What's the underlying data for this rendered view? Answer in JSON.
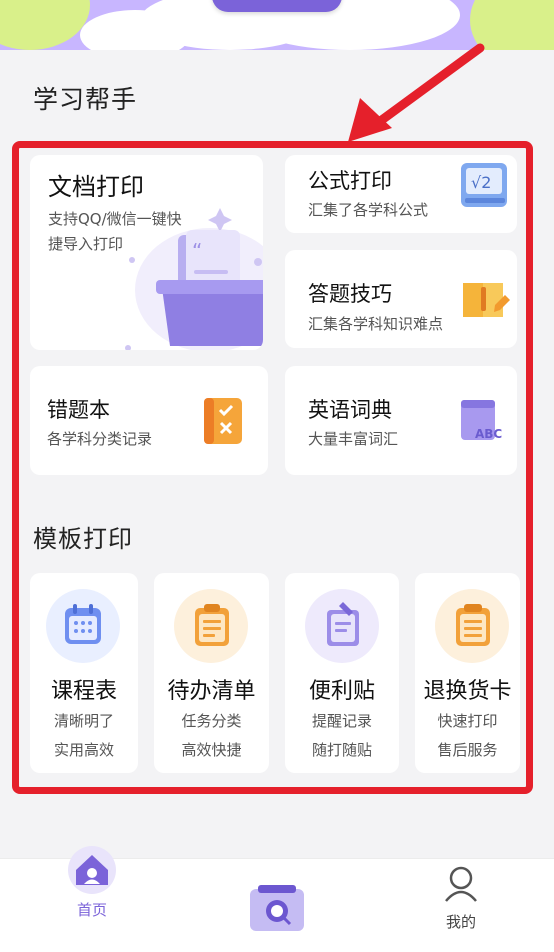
{
  "colors": {
    "accent": "#7b63d9",
    "highlight_frame": "#e5202b",
    "tab_active": "#7b63d9",
    "tab_inactive": "#444444"
  },
  "study_section": {
    "title": "学习帮手",
    "cards": [
      {
        "title": "文档打印",
        "subtitle": "支持QQ/微信一键快\n捷导入打印",
        "icon": "document-folder-icon"
      },
      {
        "title": "公式打印",
        "subtitle": "汇集了各学科公式",
        "icon": "formula-board-icon"
      },
      {
        "title": "答题技巧",
        "subtitle": "汇集各学科知识难点",
        "icon": "book-pencil-icon"
      },
      {
        "title": "错题本",
        "subtitle": "各学科分类记录",
        "icon": "mistake-notebook-icon"
      },
      {
        "title": "英语词典",
        "subtitle": "大量丰富词汇",
        "icon": "abc-dictionary-icon"
      }
    ]
  },
  "template_section": {
    "title": "模板打印",
    "items": [
      {
        "title": "课程表",
        "line1": "清晰明了",
        "line2": "实用高效",
        "icon": "calendar-icon"
      },
      {
        "title": "待办清单",
        "line1": "任务分类",
        "line2": "高效快捷",
        "icon": "clipboard-list-icon"
      },
      {
        "title": "便利贴",
        "line1": "提醒记录",
        "line2": "随打随贴",
        "icon": "sticky-note-icon"
      },
      {
        "title": "退换货卡",
        "line1": "快速打印",
        "line2": "售后服务",
        "icon": "return-card-icon"
      }
    ]
  },
  "tabbar": {
    "home": "首页",
    "scan": "",
    "mine": "我的"
  }
}
